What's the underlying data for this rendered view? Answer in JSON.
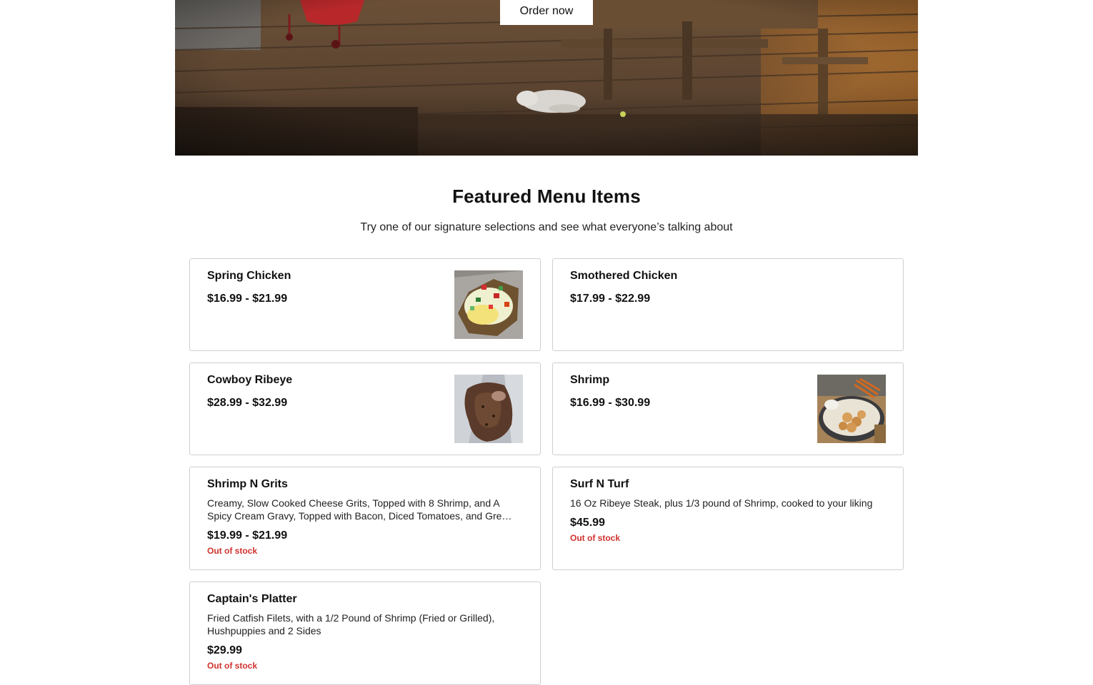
{
  "hero": {
    "order_button_label": "Order now"
  },
  "featured": {
    "title": "Featured Menu Items",
    "subtitle": "Try one of our signature selections and see what everyone’s talking about",
    "items": [
      {
        "name": "Spring Chicken",
        "price": "$16.99 - $21.99",
        "image": "spring-chicken-photo"
      },
      {
        "name": "Smothered Chicken",
        "price": "$17.99 - $22.99"
      },
      {
        "name": "Cowboy Ribeye",
        "price": "$28.99 - $32.99",
        "image": "cowboy-ribeye-photo"
      },
      {
        "name": "Shrimp",
        "price": "$16.99 - $30.99",
        "image": "shrimp-photo"
      },
      {
        "name": "Shrimp N Grits",
        "description": "Creamy, Slow Cooked Cheese Grits, Topped with 8 Shrimp, and A Spicy Cream Gravy, Topped with Bacon, Diced Tomatoes, and Green Onions",
        "price": "$19.99 - $21.99",
        "stock": "Out of stock"
      },
      {
        "name": "Surf N Turf",
        "description": "16 Oz Ribeye Steak, plus 1/3 pound of Shrimp, cooked to your liking",
        "price": "$45.99",
        "stock": "Out of stock"
      },
      {
        "name": "Captain's Platter",
        "description": "Fried Catfish Filets, with a 1/2 Pound of Shrimp (Fried or Grilled), Hushpuppies and 2 Sides",
        "price": "$29.99",
        "stock": "Out of stock"
      }
    ]
  },
  "colors": {
    "stock_red": "#d0312d",
    "card_border": "#cfcfcf"
  }
}
